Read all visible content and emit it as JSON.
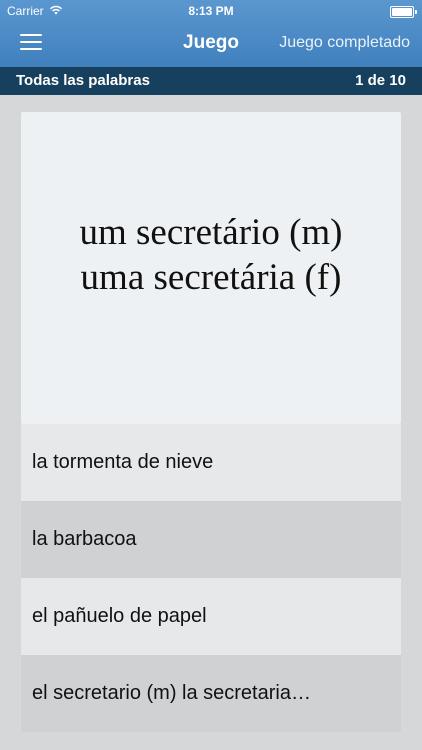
{
  "status": {
    "carrier": "Carrier",
    "time": "8:13 PM"
  },
  "navbar": {
    "title": "Juego",
    "right_label": "Juego completado"
  },
  "subbar": {
    "left_label": "Todas las palabras",
    "progress": "1 de 10"
  },
  "card": {
    "line1": "um secretário (m)",
    "line2": "uma secretária (f)"
  },
  "options": [
    "la tormenta de nieve",
    "la barbacoa",
    "el pañuelo de papel",
    "el secretario (m)  la secretaria…"
  ],
  "colors": {
    "nav_blue": "#4a8ac6",
    "subbar_navy": "#173f5e",
    "background": "#d5d7d9"
  }
}
